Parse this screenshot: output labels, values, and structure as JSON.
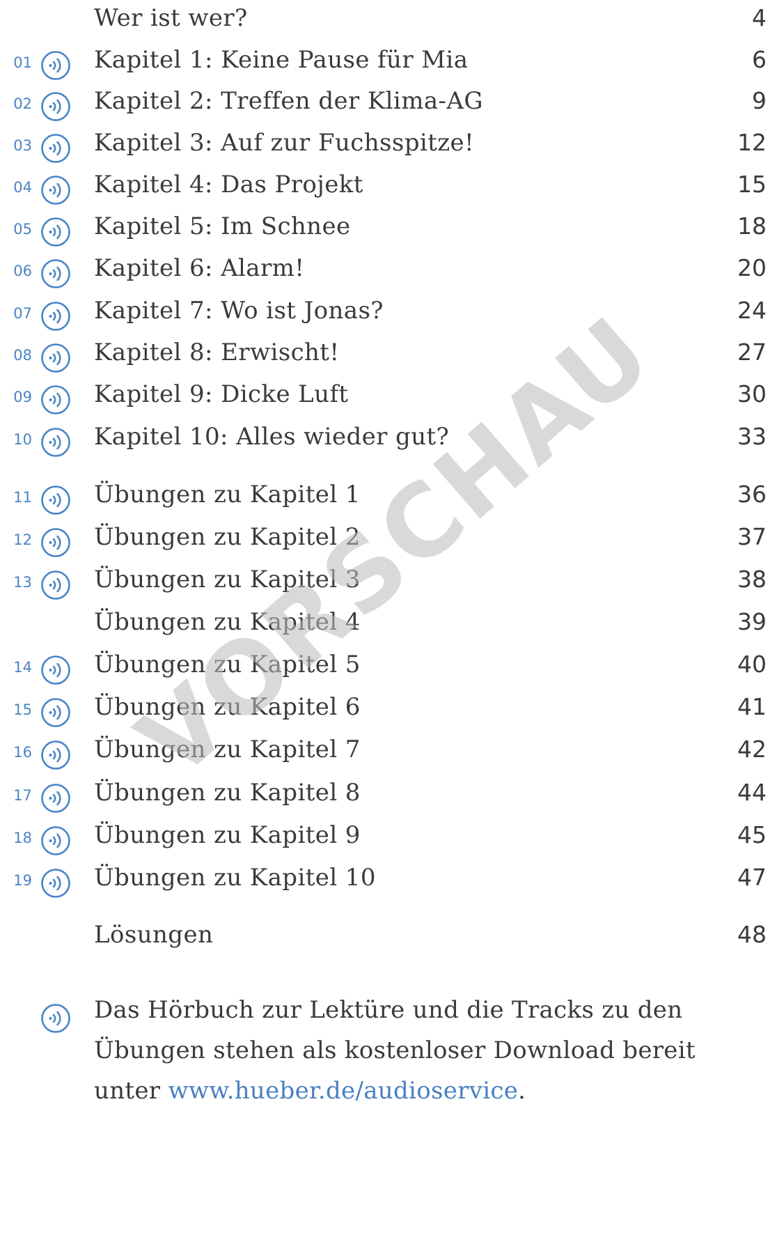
{
  "toc": [
    {
      "track": "",
      "audio": false,
      "title": "Wer ist wer?",
      "page": "4"
    },
    {
      "track": "01",
      "audio": true,
      "title": "Kapitel 1: Keine Pause für Mia",
      "page": "6"
    },
    {
      "track": "02",
      "audio": true,
      "title": "Kapitel 2: Treffen der Klima-AG",
      "page": "9"
    },
    {
      "track": "03",
      "audio": true,
      "title": "Kapitel 3: Auf zur Fuchsspitze!",
      "page": "12"
    },
    {
      "track": "04",
      "audio": true,
      "title": "Kapitel 4: Das Projekt",
      "page": "15"
    },
    {
      "track": "05",
      "audio": true,
      "title": "Kapitel 5: Im Schnee",
      "page": "18"
    },
    {
      "track": "06",
      "audio": true,
      "title": "Kapitel 6: Alarm!",
      "page": "20"
    },
    {
      "track": "07",
      "audio": true,
      "title": "Kapitel 7: Wo ist Jonas?",
      "page": "24"
    },
    {
      "track": "08",
      "audio": true,
      "title": "Kapitel 8: Erwischt!",
      "page": "27"
    },
    {
      "track": "09",
      "audio": true,
      "title": "Kapitel 9: Dicke Luft",
      "page": "30"
    },
    {
      "track": "10",
      "audio": true,
      "title": "Kapitel 10: Alles wieder gut?",
      "page": "33"
    },
    {
      "track": "11",
      "audio": true,
      "title": "Übungen zu Kapitel 1",
      "page": "36"
    },
    {
      "track": "12",
      "audio": true,
      "title": "Übungen zu Kapitel 2",
      "page": "37"
    },
    {
      "track": "13",
      "audio": true,
      "title": "Übungen zu Kapitel 3",
      "page": "38"
    },
    {
      "track": "",
      "audio": false,
      "title": "Übungen zu Kapitel 4",
      "page": "39"
    },
    {
      "track": "14",
      "audio": true,
      "title": "Übungen zu Kapitel 5",
      "page": "40"
    },
    {
      "track": "15",
      "audio": true,
      "title": "Übungen zu Kapitel 6",
      "page": "41"
    },
    {
      "track": "16",
      "audio": true,
      "title": "Übungen zu Kapitel 7",
      "page": "42"
    },
    {
      "track": "17",
      "audio": true,
      "title": "Übungen zu Kapitel 8",
      "page": "44"
    },
    {
      "track": "18",
      "audio": true,
      "title": "Übungen zu Kapitel 9",
      "page": "45"
    },
    {
      "track": "19",
      "audio": true,
      "title": "Übungen zu Kapitel 10",
      "page": "47"
    },
    {
      "track": "",
      "audio": false,
      "title": "Lösungen",
      "page": "48"
    }
  ],
  "note": {
    "icon": "audio-icon",
    "line1": "Das Hörbuch zur Lektüre und die Tracks zu den",
    "line2": "Übungen stehen als kostenloser Download bereit",
    "line3_prefix": "unter ",
    "link": "www.hueber.de/audioservice",
    "line3_suffix": "."
  },
  "watermark": "VORSCHAU",
  "colors": {
    "accent": "#4a84c4",
    "text": "#3a3a3a",
    "watermark": "#b9b9b9"
  }
}
